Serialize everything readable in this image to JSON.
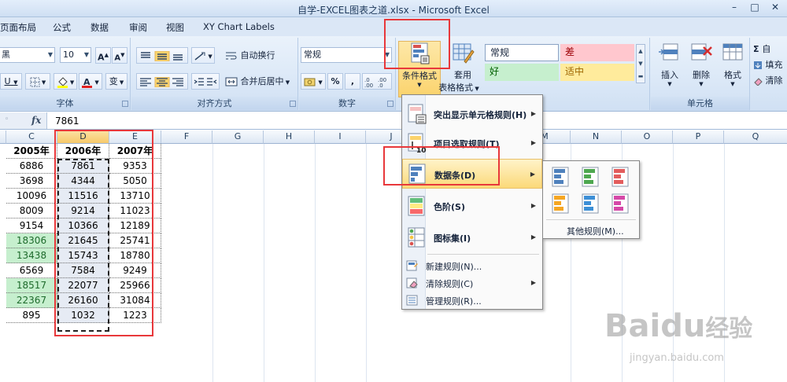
{
  "window": {
    "title": "自学-EXCEL图表之道.xlsx - Microsoft Excel"
  },
  "tabs": [
    "页面布局",
    "公式",
    "数据",
    "审阅",
    "视图",
    "XY Chart Labels"
  ],
  "ribbon": {
    "font_group": {
      "label": "字体",
      "font_name": "黑",
      "font_size": "10",
      "grow_label": "A",
      "shrink_label": "A",
      "underline": "U",
      "wen_label": "变"
    },
    "align_group": {
      "label": "对齐方式",
      "wrap_text": "自动换行",
      "merge_center": "合并后居中"
    },
    "number_group": {
      "label": "数字",
      "format": "常规",
      "percent": "%",
      "comma": ","
    },
    "styles_group": {
      "cond_format": "条件格式",
      "table_format_1": "套用",
      "table_format_2": "表格格式",
      "cell_styles": [
        {
          "label": "常规",
          "bg": "#ffffff",
          "fg": "#000000"
        },
        {
          "label": "差",
          "bg": "#ffc7ce",
          "fg": "#9c0006"
        },
        {
          "label": "好",
          "bg": "#c6efce",
          "fg": "#006100"
        },
        {
          "label": "适中",
          "bg": "#ffeb9c",
          "fg": "#9c6500"
        }
      ]
    },
    "cells_group": {
      "label": "单元格",
      "insert": "插入",
      "delete": "删除",
      "format": "格式"
    },
    "edit_group": {
      "sigma": "Σ",
      "auto_sum": "自",
      "fill": "填充",
      "clear": "清除"
    }
  },
  "formula": {
    "fx": "fx",
    "value": "7861"
  },
  "columns": [
    "C",
    "D",
    "E",
    "F",
    "G",
    "H",
    "I",
    "J",
    "M",
    "N",
    "O",
    "P",
    "Q"
  ],
  "table": {
    "headers": [
      "2005年",
      "2006年",
      "2007年"
    ],
    "rows": [
      {
        "c": "6886",
        "d": "7861",
        "e": "9353",
        "style": ""
      },
      {
        "c": "3698",
        "d": "4344",
        "e": "5050",
        "style": ""
      },
      {
        "c": "10096",
        "d": "11516",
        "e": "13710",
        "style": ""
      },
      {
        "c": "8009",
        "d": "9214",
        "e": "11023",
        "style": ""
      },
      {
        "c": "9154",
        "d": "10366",
        "e": "12189",
        "style": ""
      },
      {
        "c": "18306",
        "d": "21645",
        "e": "25741",
        "style": "green"
      },
      {
        "c": "13438",
        "d": "15743",
        "e": "18780",
        "style": "green"
      },
      {
        "c": "6569",
        "d": "7584",
        "e": "9249",
        "style": ""
      },
      {
        "c": "18517",
        "d": "22077",
        "e": "25966",
        "style": "green"
      },
      {
        "c": "22367",
        "d": "26160",
        "e": "31084",
        "style": "green"
      },
      {
        "c": "895",
        "d": "1032",
        "e": "1223",
        "style": ""
      }
    ]
  },
  "cond_menu": {
    "items": [
      {
        "label": "突出显示单元格规则(H)",
        "has_sub": true
      },
      {
        "label": "项目选取规则(T)",
        "has_sub": true
      },
      {
        "label": "数据条(D)",
        "has_sub": true,
        "highlight": true
      },
      {
        "label": "色阶(S)",
        "has_sub": true
      },
      {
        "label": "图标集(I)",
        "has_sub": true
      }
    ],
    "small_items": [
      {
        "label": "新建规则(N)...",
        "has_sub": false
      },
      {
        "label": "清除规则(C)",
        "has_sub": true
      },
      {
        "label": "管理规则(R)...",
        "has_sub": false
      }
    ]
  },
  "databar_menu": {
    "colors": [
      "#4f81bd",
      "#4ea850",
      "#e35d5d",
      "#f5a623",
      "#3d8fd6",
      "#d548a8"
    ],
    "more": "其他规则(M)..."
  },
  "watermark": {
    "brand": "Baidu",
    "brand_cn": "经验",
    "url": "jingyan.baidu.com"
  }
}
